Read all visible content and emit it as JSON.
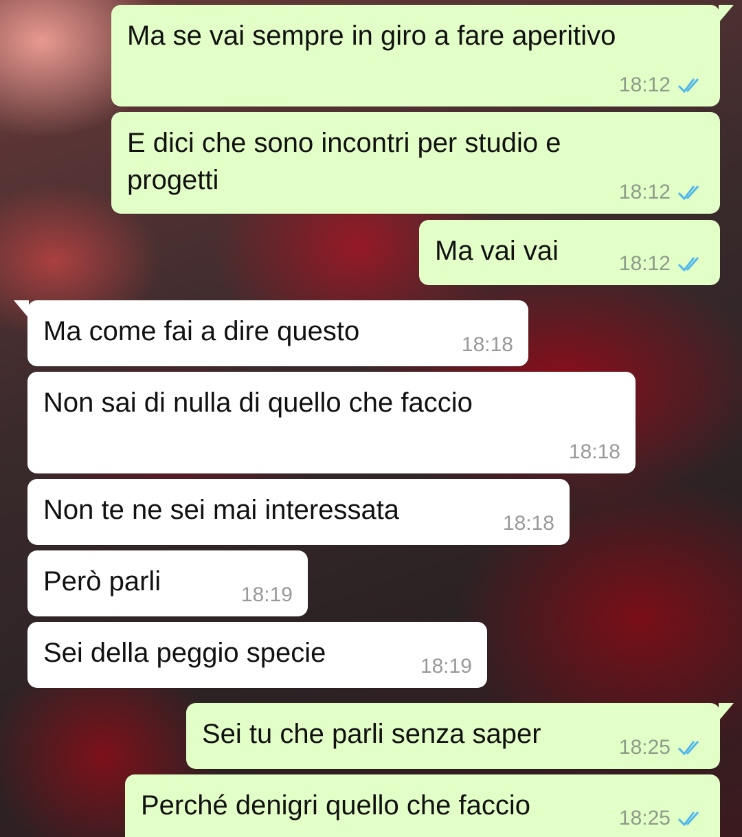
{
  "messages": [
    {
      "text": "Ma se vai sempre in giro a fare aperitivo",
      "time": "18:12",
      "status": "read-double-check-icon",
      "direction": "outgoing"
    },
    {
      "text": "E dici che sono incontri per studio e\nprogetti",
      "time": "18:12",
      "status": "read-double-check-icon",
      "direction": "outgoing"
    },
    {
      "text": "Ma vai vai",
      "time": "18:12",
      "status": "read-double-check-icon",
      "direction": "outgoing"
    },
    {
      "text": "Ma come fai a dire questo",
      "time": "18:18",
      "direction": "incoming"
    },
    {
      "text": "Non sai di nulla di quello che faccio",
      "time": "18:18",
      "direction": "incoming"
    },
    {
      "text": "Non te ne sei mai interessata",
      "time": "18:18",
      "direction": "incoming"
    },
    {
      "text": "Però parli",
      "time": "18:19",
      "direction": "incoming"
    },
    {
      "text": "Sei della peggio specie",
      "time": "18:19",
      "direction": "incoming"
    },
    {
      "text": "Sei tu che parli senza saper",
      "time": "18:25",
      "status": "read-double-check-icon",
      "direction": "outgoing"
    },
    {
      "text": "Perché denigri quello che faccio",
      "time": "18:25",
      "status": "read-double-check-icon",
      "direction": "outgoing"
    }
  ],
  "colors": {
    "outgoing_bubble": "#e2ffc7",
    "incoming_bubble": "#ffffff",
    "read_tick": "#4fb6ec",
    "timestamp": "#8e9a8a"
  }
}
